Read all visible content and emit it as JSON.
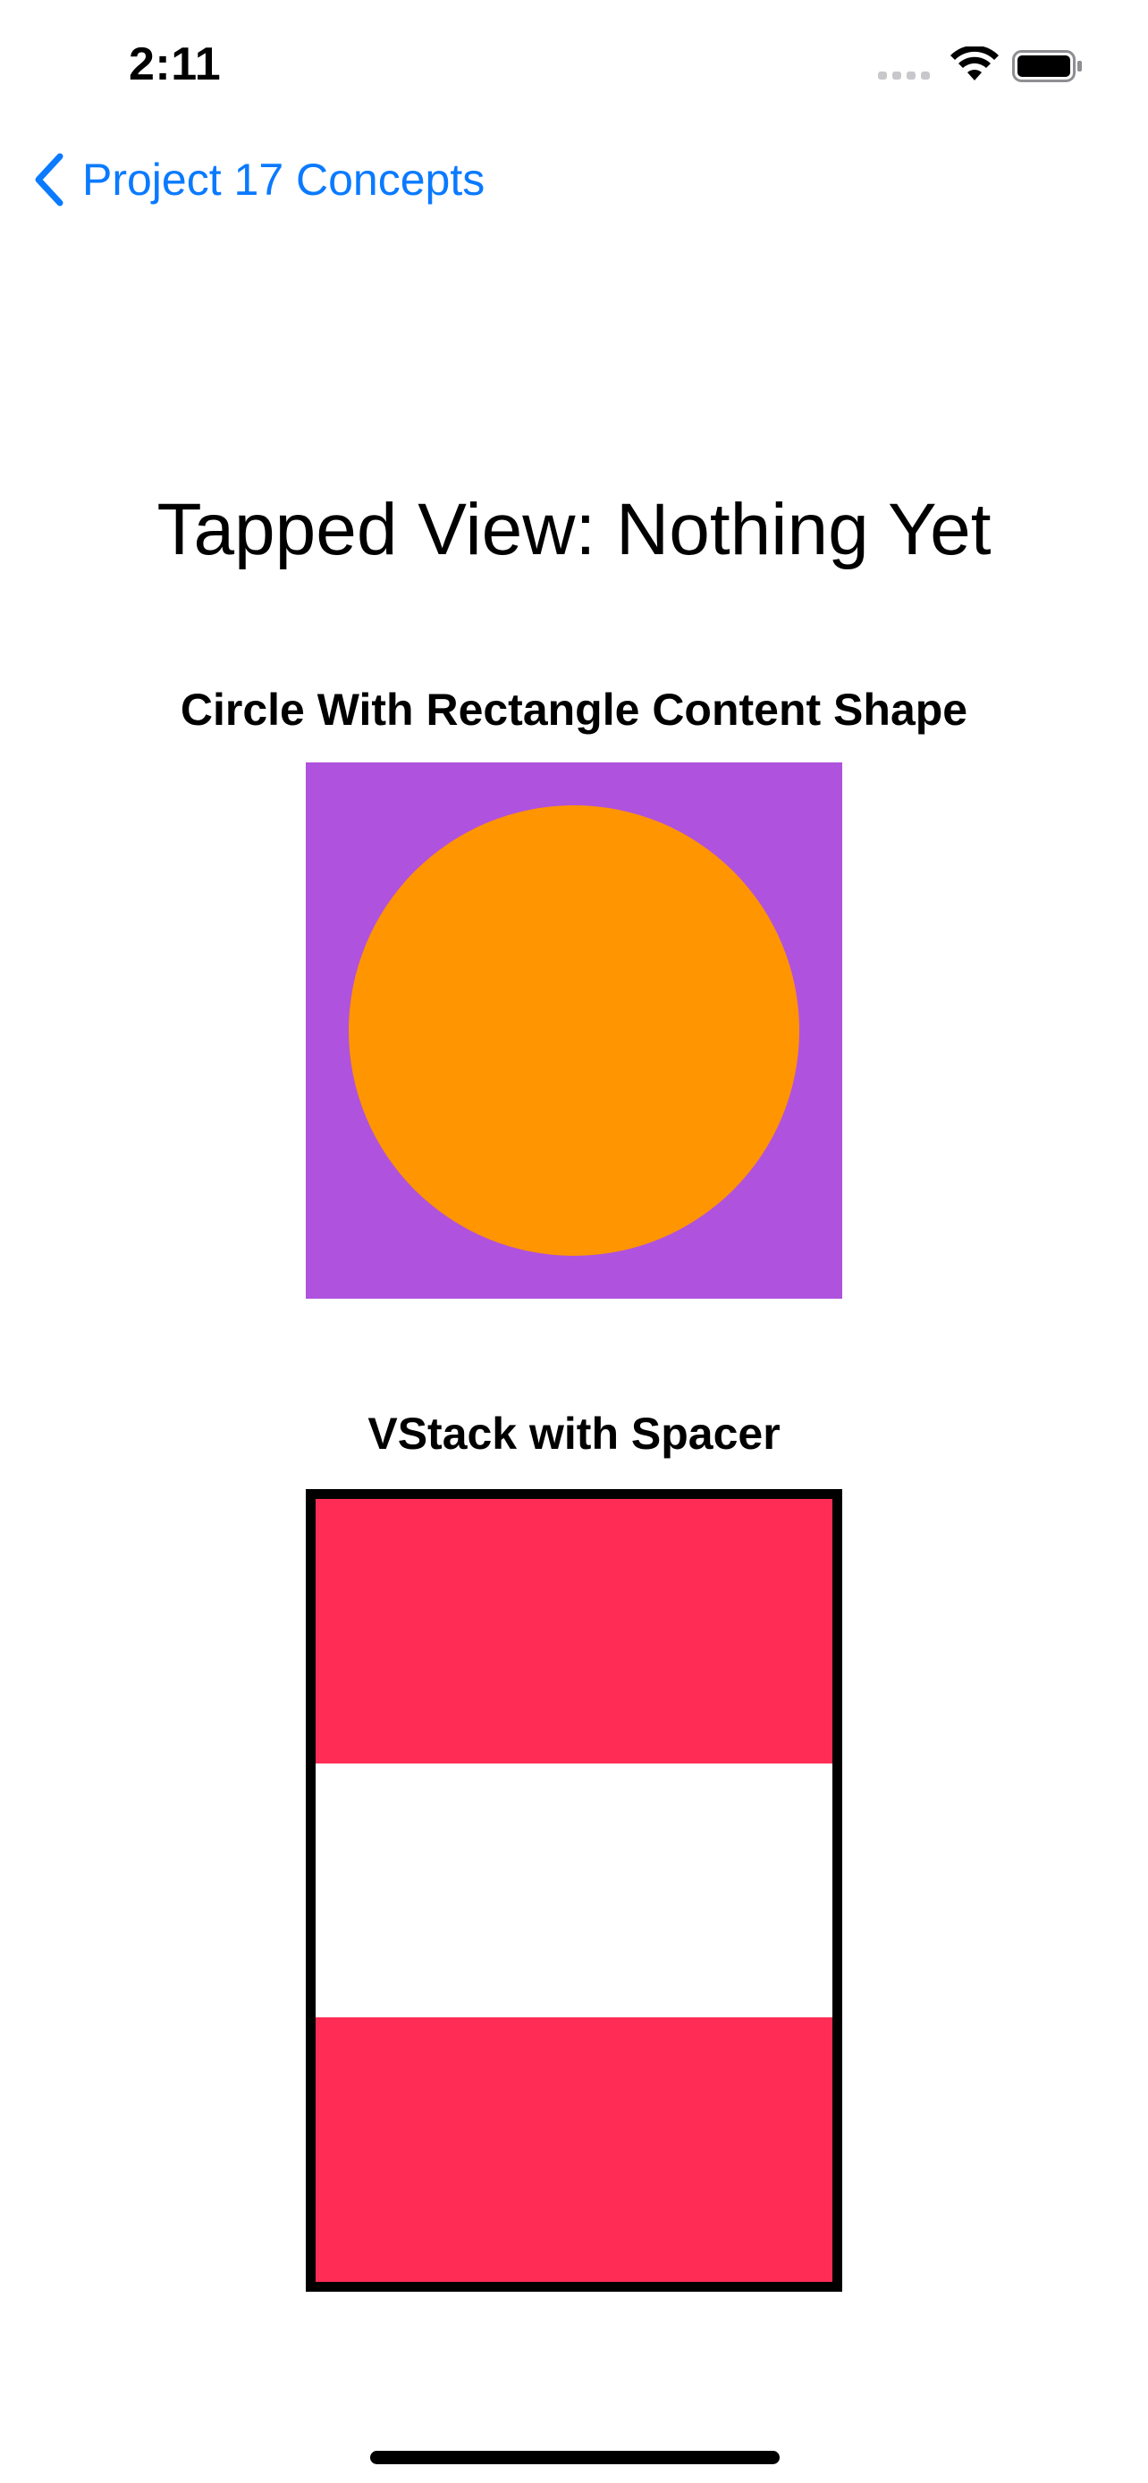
{
  "status_bar": {
    "time": "2:11",
    "icons": [
      "cellular-signal-icon",
      "wifi-icon",
      "battery-icon"
    ]
  },
  "nav": {
    "back_label": "Project 17 Concepts",
    "back_icon": "chevron-left-icon",
    "accent_color": "#0a7aff"
  },
  "main": {
    "title": "Tapped View: Nothing Yet",
    "sections": [
      {
        "title": "Circle With Rectangle Content Shape",
        "background_color": "#af52de",
        "circle_color": "#ff9500"
      },
      {
        "title": "VStack with Spacer",
        "bar_color": "#ff2d55",
        "border_color": "#000000"
      }
    ]
  }
}
